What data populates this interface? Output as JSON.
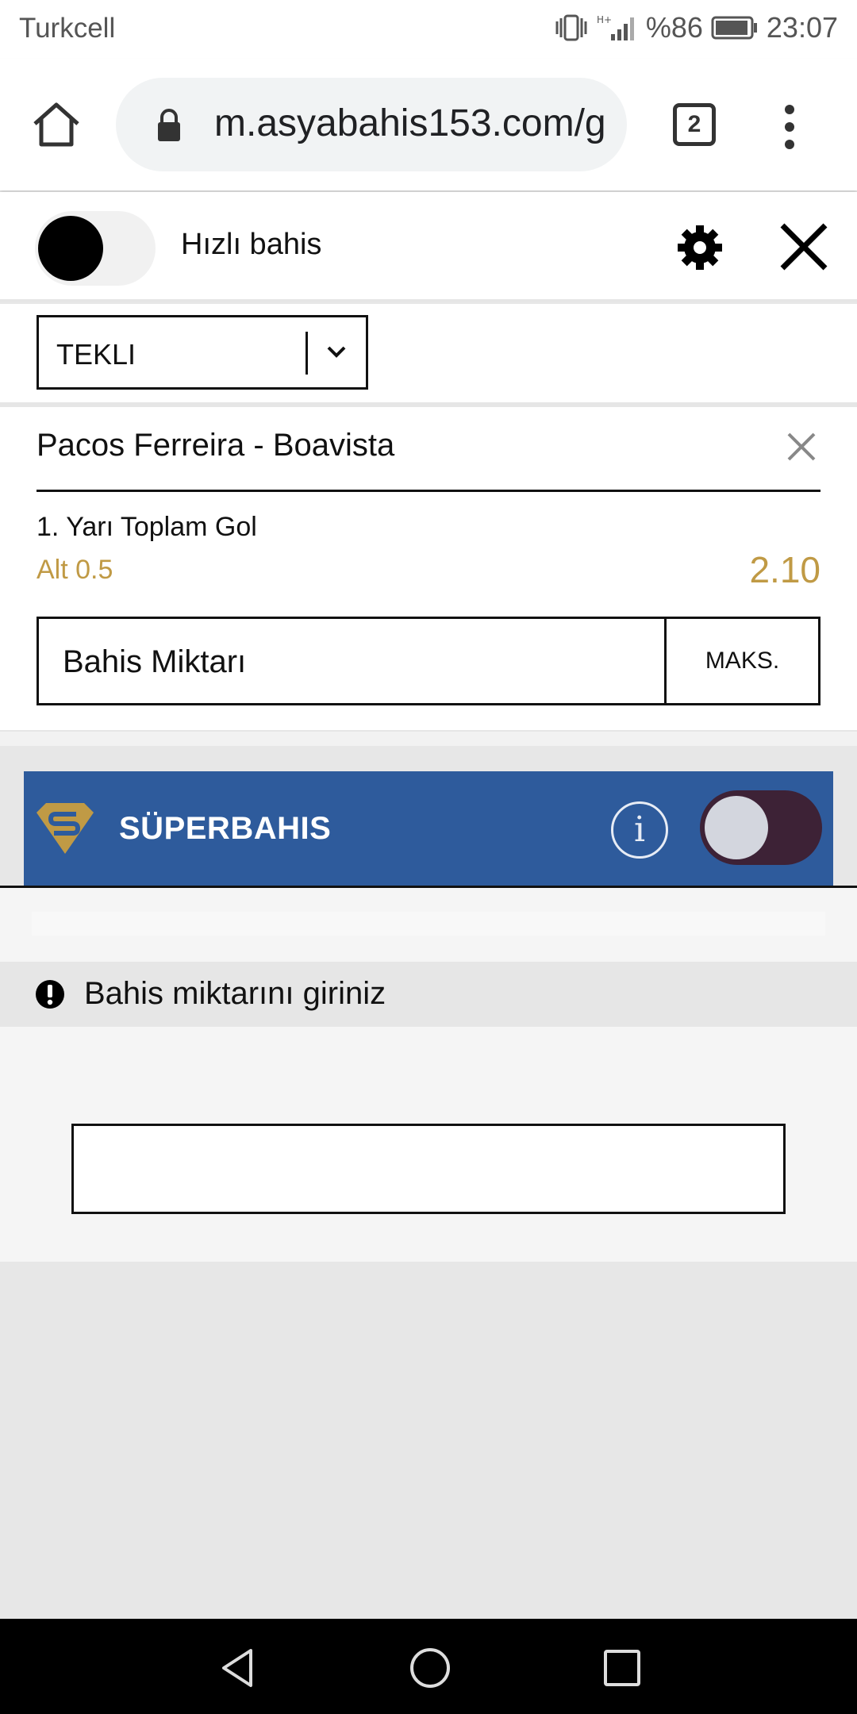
{
  "status_bar": {
    "carrier": "Turkcell",
    "battery_percent": "%86",
    "time": "23:07"
  },
  "browser": {
    "url": "m.asyabahis153.com/g",
    "tab_count": "2"
  },
  "slip": {
    "quick_bet_label": "Hızlı bahis",
    "bet_type": "TEKLI",
    "selection": {
      "match": "Pacos Ferreira - Boavista",
      "market": "1. Yarı Toplam Gol",
      "outcome": "Alt 0.5",
      "odds": "2.10"
    },
    "stake_placeholder": "Bahis Miktarı",
    "max_label": "MAKS.",
    "superbahis_label": "SÜPERBAHIS",
    "info_symbol": "i",
    "alert_text": "Bahis miktarını giriniz"
  },
  "colors": {
    "accent_gold": "#c09a45",
    "superbahis_blue": "#2e5b9c"
  }
}
